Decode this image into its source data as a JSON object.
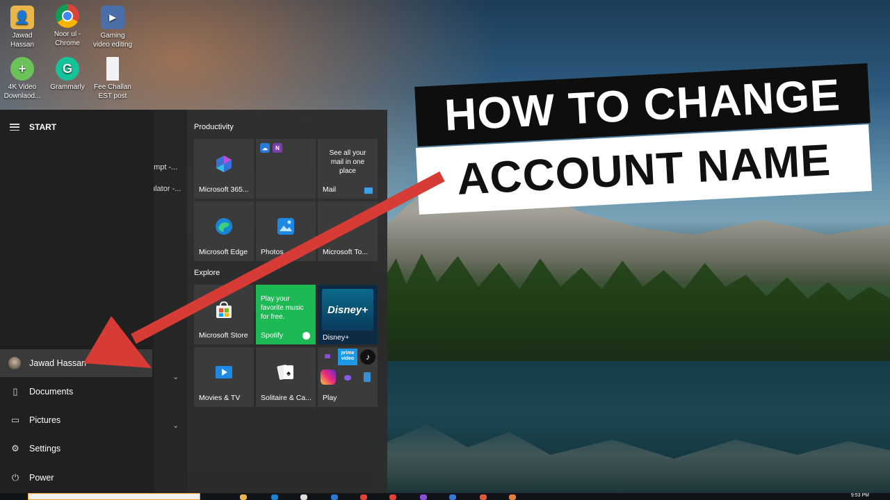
{
  "desktop": {
    "icons": [
      {
        "label_1": "Jawad",
        "label_2": "Hassan",
        "icon": "folder-user-icon",
        "color": "#e8b64a"
      },
      {
        "label_1": "Noor ul -",
        "label_2": "Chrome",
        "icon": "chrome-icon",
        "color": "#db4437"
      },
      {
        "label_1": "Gaming",
        "label_2": "video editing",
        "icon": "video-file-icon",
        "color": "#4a6ea8"
      },
      {
        "label_1": "4K Video",
        "label_2": "Downlaod...",
        "icon": "4k-video-downloader-icon",
        "color": "#6ac259"
      },
      {
        "label_1": "Grammarly",
        "label_2": "",
        "icon": "grammarly-icon",
        "color": "#15c39a"
      },
      {
        "label_1": "Fee Challan",
        "label_2": "EST post",
        "icon": "document-icon",
        "color": "#f2f2f2"
      }
    ]
  },
  "overlay": {
    "line_1": "HOW TO CHANGE",
    "line_2": "ACCOUNT NAME",
    "arrow_color": "#d73b36"
  },
  "start_menu": {
    "header": "START",
    "left_items": [
      {
        "label": "Jawad Hassan",
        "icon": "avatar"
      },
      {
        "label": "Documents",
        "icon": "document-icon"
      },
      {
        "label": "Pictures",
        "icon": "pictures-icon"
      },
      {
        "label": "Settings",
        "icon": "gear-icon"
      },
      {
        "label": "Power",
        "icon": "power-icon"
      }
    ],
    "applist_snippets": [
      "ompt -...",
      "ulator -..."
    ],
    "groups": {
      "productivity": "Productivity",
      "explore": "Explore"
    },
    "tiles": {
      "microsoft365": "Microsoft 365...",
      "mail_desc": "See all your mail in one place",
      "mail": "Mail",
      "edge": "Microsoft Edge",
      "photos": "Photos",
      "todo": "Microsoft To...",
      "store": "Microsoft Store",
      "spotify_promo": "Play your favorite music for free.",
      "spotify": "Spotify",
      "disney_logo": "Disney+",
      "disney": "Disney+",
      "movies": "Movies & TV",
      "solitaire": "Solitaire & Ca...",
      "play": "Play",
      "prime_video": "prime video"
    }
  },
  "taskbar": {
    "clock": "9:53 PM"
  }
}
